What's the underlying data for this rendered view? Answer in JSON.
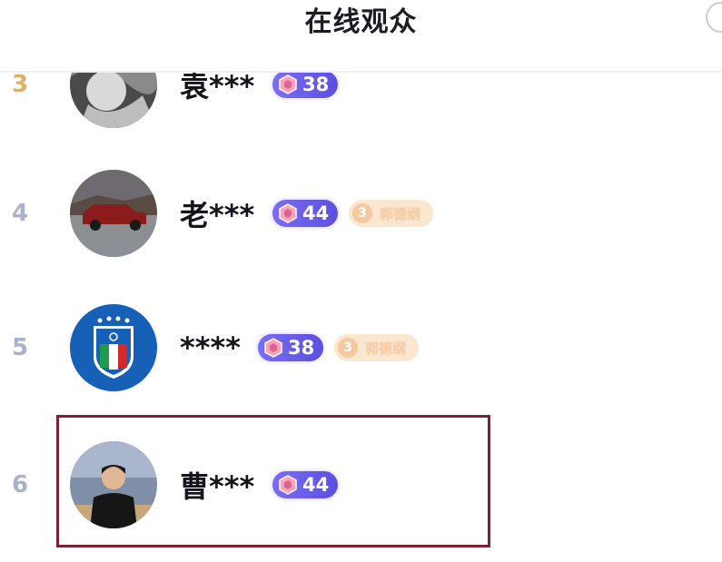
{
  "header": {
    "title": "在线观众"
  },
  "viewers": [
    {
      "rank": "3",
      "name": "袁***",
      "level": "38",
      "fan_badge": null
    },
    {
      "rank": "4",
      "name": "老***",
      "level": "44",
      "fan_badge": {
        "level": "3",
        "name": "郭德纲"
      }
    },
    {
      "rank": "5",
      "name": "****",
      "level": "38",
      "fan_badge": {
        "level": "3",
        "name": "郭德纲"
      }
    },
    {
      "rank": "6",
      "name": "曹***",
      "level": "44",
      "fan_badge": null
    }
  ],
  "colors": {
    "level_badge": "#6a5de8",
    "fan_badge": "#fbe6cf",
    "highlight_border": "#7e2130",
    "rank_top3": "#e0b066",
    "rank": "#aab1cc"
  },
  "icons": {
    "level_badge": "gem-icon",
    "close": "close-icon"
  }
}
